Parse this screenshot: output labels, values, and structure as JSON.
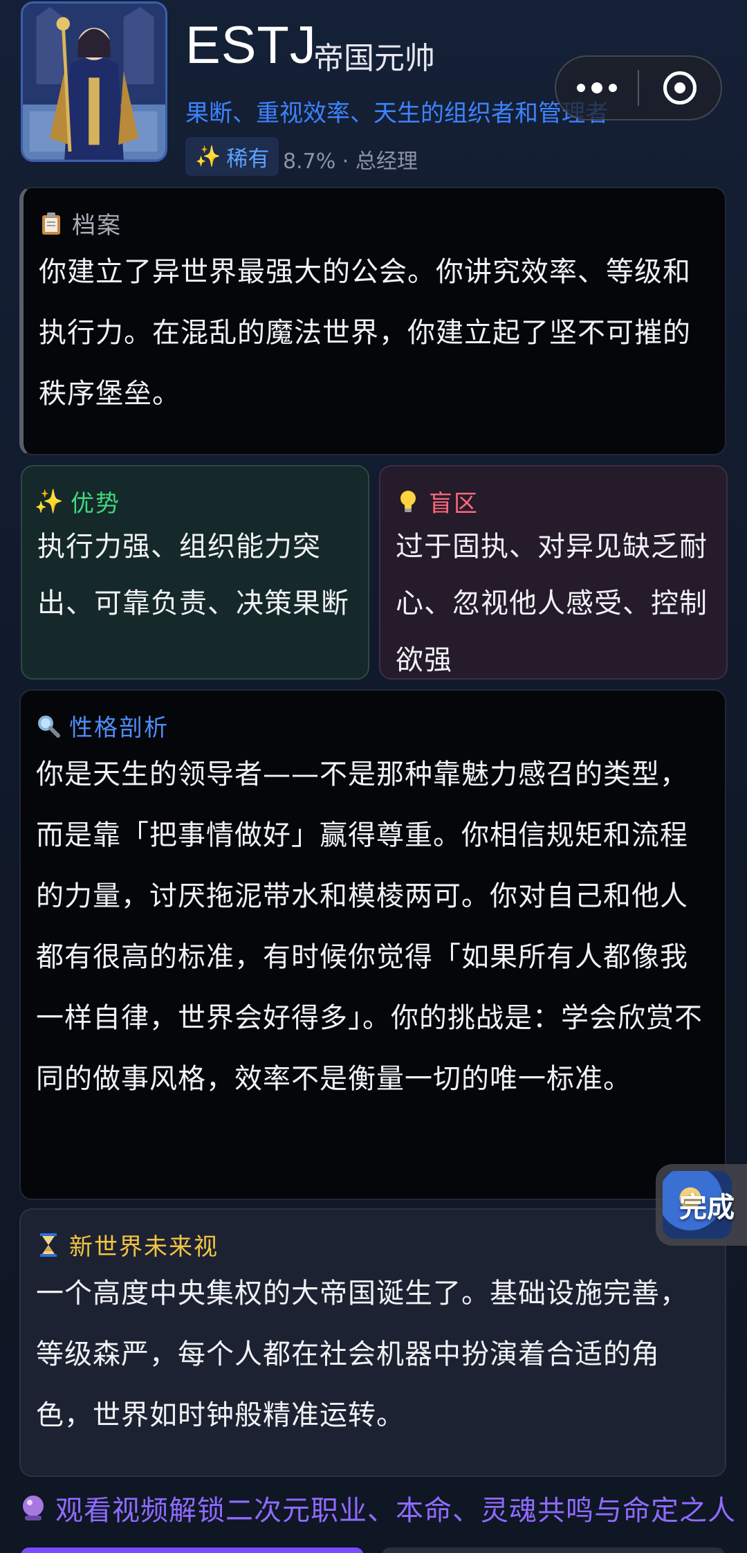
{
  "header": {
    "type_code": "ESTJ",
    "type_title": "帝国元帅",
    "tagline": "果断、重视效率、天生的组织者和管理者",
    "rarity_label": "稀有",
    "stats": "8.7% · 总经理"
  },
  "cards": {
    "archive": {
      "title": "档案",
      "body": "你建立了异世界最强大的公会。你讲究效率、等级和执行力。在混乱的魔法世界，你建立起了坚不可摧的秩序堡垒。"
    },
    "strength": {
      "title": "优势",
      "body": "执行力强、组织能力突出、可靠负责、决策果断"
    },
    "blind_spot": {
      "title": "盲区",
      "body": "过于固执、对异见缺乏耐心、忽视他人感受、控制欲强"
    },
    "analysis": {
      "title": "性格剖析",
      "body": "你是天生的领导者——不是那种靠魅力感召的类型，而是靠「把事情做好」赢得尊重。你相信规矩和流程的力量，讨厌拖泥带水和模棱两可。你对自己和他人都有很高的标准，有时候你觉得「如果所有人都像我一样自律，世界会好得多」。你的挑战是：学会欣赏不同的做事风格，效率不是衡量一切的唯一标准。"
    },
    "future": {
      "title": "新世界未来视",
      "body": "一个高度中央集权的大帝国诞生了。基础设施完善，等级森严，每个人都在社会机器中扮演着合适的角色，世界如时钟般精准运转。"
    }
  },
  "done_button": {
    "label": "完成"
  },
  "unlock_link": "观看视频解锁二次元职业、本命、灵魂共鸣与命定之人",
  "icons": {
    "archive": "clipboard-icon",
    "strength": "sparkles-icon",
    "blind_spot": "lightbulb-icon",
    "analysis": "magnifier-icon",
    "future": "hourglass-icon",
    "unlock": "crystal-ball-icon"
  },
  "colors": {
    "accent_blue": "#3d83ff",
    "strength_green": "#3fd87a",
    "blind_red": "#ff6a78",
    "future_gold": "#f2c643",
    "unlock_purple": "#8f6bff"
  }
}
